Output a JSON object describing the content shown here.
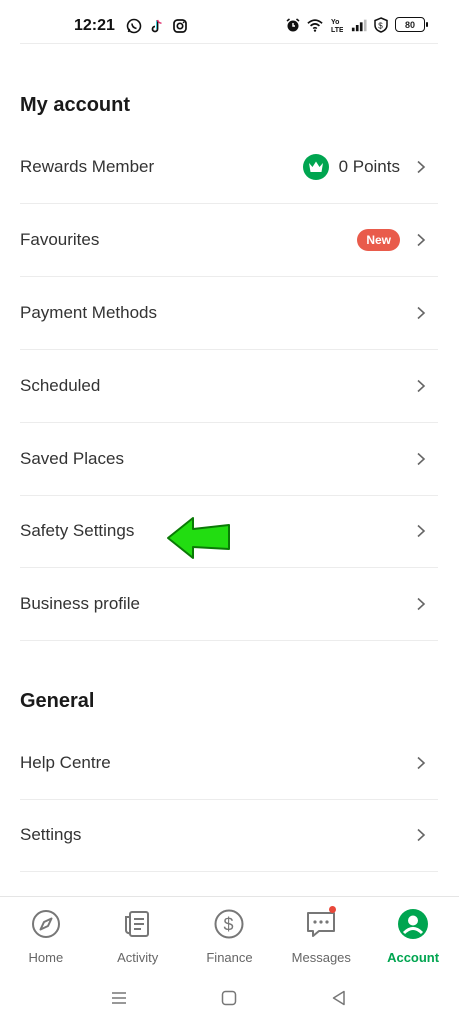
{
  "status_bar": {
    "time": "12:21",
    "battery": "80",
    "icons_left": [
      "whatsapp-icon",
      "tiktok-icon",
      "instagram-icon"
    ],
    "icons_right": [
      "alarm-icon",
      "wifi-icon",
      "volte-icon",
      "signal-icon",
      "vpn-icon",
      "battery-icon"
    ]
  },
  "colors": {
    "accent": "#00a550",
    "badge_red": "#e95b4b"
  },
  "sections": {
    "my_account": {
      "title": "My account",
      "items": [
        {
          "label": "Rewards Member",
          "points": "0 Points"
        },
        {
          "label": "Favourites",
          "badge": "New"
        },
        {
          "label": "Payment Methods"
        },
        {
          "label": "Scheduled"
        },
        {
          "label": "Saved Places"
        },
        {
          "label": "Safety Settings"
        },
        {
          "label": "Business profile"
        }
      ]
    },
    "general": {
      "title": "General",
      "items": [
        {
          "label": "Help Centre"
        },
        {
          "label": "Settings"
        }
      ]
    }
  },
  "bottom_nav": {
    "items": [
      {
        "label": "Home",
        "icon": "compass-icon"
      },
      {
        "label": "Activity",
        "icon": "receipt-icon"
      },
      {
        "label": "Finance",
        "icon": "dollar-icon"
      },
      {
        "label": "Messages",
        "icon": "chat-icon",
        "notification": true
      },
      {
        "label": "Account",
        "icon": "user-icon",
        "active": true
      }
    ]
  }
}
